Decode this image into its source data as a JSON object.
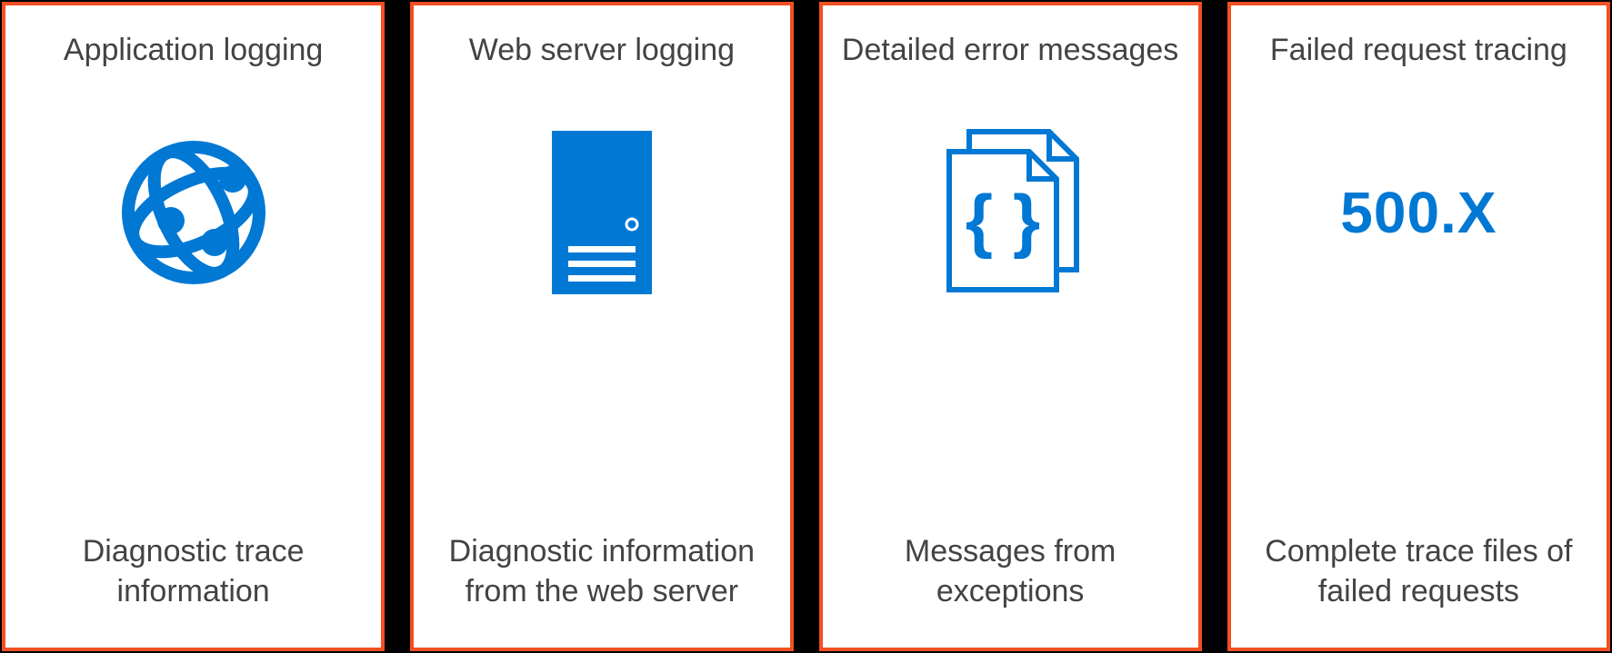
{
  "cards": [
    {
      "title": "Application logging",
      "description": "Diagnostic trace information",
      "icon": "globe-network-icon"
    },
    {
      "title": "Web server logging",
      "description": "Diagnostic information from the web server",
      "icon": "server-icon"
    },
    {
      "title": "Detailed error messages",
      "description": "Messages from exceptions",
      "icon": "braces-document-icon"
    },
    {
      "title": "Failed request tracing",
      "description": "Complete trace files of failed requests",
      "icon": "http-code",
      "code": "500.X"
    }
  ],
  "colors": {
    "border": "#F25022",
    "icon": "#0078D4",
    "text": "#434343"
  }
}
